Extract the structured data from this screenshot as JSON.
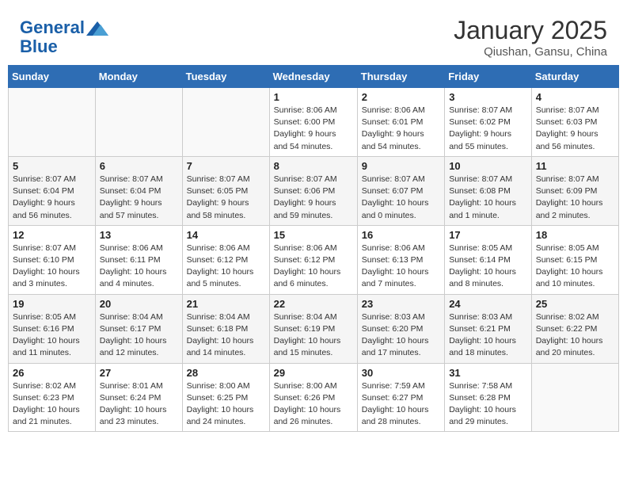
{
  "header": {
    "logo_line1": "General",
    "logo_line2": "Blue",
    "title": "January 2025",
    "subtitle": "Qiushan, Gansu, China"
  },
  "days_of_week": [
    "Sunday",
    "Monday",
    "Tuesday",
    "Wednesday",
    "Thursday",
    "Friday",
    "Saturday"
  ],
  "weeks": [
    {
      "days": [
        {
          "num": "",
          "info": ""
        },
        {
          "num": "",
          "info": ""
        },
        {
          "num": "",
          "info": ""
        },
        {
          "num": "1",
          "info": "Sunrise: 8:06 AM\nSunset: 6:00 PM\nDaylight: 9 hours\nand 54 minutes."
        },
        {
          "num": "2",
          "info": "Sunrise: 8:06 AM\nSunset: 6:01 PM\nDaylight: 9 hours\nand 54 minutes."
        },
        {
          "num": "3",
          "info": "Sunrise: 8:07 AM\nSunset: 6:02 PM\nDaylight: 9 hours\nand 55 minutes."
        },
        {
          "num": "4",
          "info": "Sunrise: 8:07 AM\nSunset: 6:03 PM\nDaylight: 9 hours\nand 56 minutes."
        }
      ]
    },
    {
      "days": [
        {
          "num": "5",
          "info": "Sunrise: 8:07 AM\nSunset: 6:04 PM\nDaylight: 9 hours\nand 56 minutes."
        },
        {
          "num": "6",
          "info": "Sunrise: 8:07 AM\nSunset: 6:04 PM\nDaylight: 9 hours\nand 57 minutes."
        },
        {
          "num": "7",
          "info": "Sunrise: 8:07 AM\nSunset: 6:05 PM\nDaylight: 9 hours\nand 58 minutes."
        },
        {
          "num": "8",
          "info": "Sunrise: 8:07 AM\nSunset: 6:06 PM\nDaylight: 9 hours\nand 59 minutes."
        },
        {
          "num": "9",
          "info": "Sunrise: 8:07 AM\nSunset: 6:07 PM\nDaylight: 10 hours\nand 0 minutes."
        },
        {
          "num": "10",
          "info": "Sunrise: 8:07 AM\nSunset: 6:08 PM\nDaylight: 10 hours\nand 1 minute."
        },
        {
          "num": "11",
          "info": "Sunrise: 8:07 AM\nSunset: 6:09 PM\nDaylight: 10 hours\nand 2 minutes."
        }
      ]
    },
    {
      "days": [
        {
          "num": "12",
          "info": "Sunrise: 8:07 AM\nSunset: 6:10 PM\nDaylight: 10 hours\nand 3 minutes."
        },
        {
          "num": "13",
          "info": "Sunrise: 8:06 AM\nSunset: 6:11 PM\nDaylight: 10 hours\nand 4 minutes."
        },
        {
          "num": "14",
          "info": "Sunrise: 8:06 AM\nSunset: 6:12 PM\nDaylight: 10 hours\nand 5 minutes."
        },
        {
          "num": "15",
          "info": "Sunrise: 8:06 AM\nSunset: 6:12 PM\nDaylight: 10 hours\nand 6 minutes."
        },
        {
          "num": "16",
          "info": "Sunrise: 8:06 AM\nSunset: 6:13 PM\nDaylight: 10 hours\nand 7 minutes."
        },
        {
          "num": "17",
          "info": "Sunrise: 8:05 AM\nSunset: 6:14 PM\nDaylight: 10 hours\nand 8 minutes."
        },
        {
          "num": "18",
          "info": "Sunrise: 8:05 AM\nSunset: 6:15 PM\nDaylight: 10 hours\nand 10 minutes."
        }
      ]
    },
    {
      "days": [
        {
          "num": "19",
          "info": "Sunrise: 8:05 AM\nSunset: 6:16 PM\nDaylight: 10 hours\nand 11 minutes."
        },
        {
          "num": "20",
          "info": "Sunrise: 8:04 AM\nSunset: 6:17 PM\nDaylight: 10 hours\nand 12 minutes."
        },
        {
          "num": "21",
          "info": "Sunrise: 8:04 AM\nSunset: 6:18 PM\nDaylight: 10 hours\nand 14 minutes."
        },
        {
          "num": "22",
          "info": "Sunrise: 8:04 AM\nSunset: 6:19 PM\nDaylight: 10 hours\nand 15 minutes."
        },
        {
          "num": "23",
          "info": "Sunrise: 8:03 AM\nSunset: 6:20 PM\nDaylight: 10 hours\nand 17 minutes."
        },
        {
          "num": "24",
          "info": "Sunrise: 8:03 AM\nSunset: 6:21 PM\nDaylight: 10 hours\nand 18 minutes."
        },
        {
          "num": "25",
          "info": "Sunrise: 8:02 AM\nSunset: 6:22 PM\nDaylight: 10 hours\nand 20 minutes."
        }
      ]
    },
    {
      "days": [
        {
          "num": "26",
          "info": "Sunrise: 8:02 AM\nSunset: 6:23 PM\nDaylight: 10 hours\nand 21 minutes."
        },
        {
          "num": "27",
          "info": "Sunrise: 8:01 AM\nSunset: 6:24 PM\nDaylight: 10 hours\nand 23 minutes."
        },
        {
          "num": "28",
          "info": "Sunrise: 8:00 AM\nSunset: 6:25 PM\nDaylight: 10 hours\nand 24 minutes."
        },
        {
          "num": "29",
          "info": "Sunrise: 8:00 AM\nSunset: 6:26 PM\nDaylight: 10 hours\nand 26 minutes."
        },
        {
          "num": "30",
          "info": "Sunrise: 7:59 AM\nSunset: 6:27 PM\nDaylight: 10 hours\nand 28 minutes."
        },
        {
          "num": "31",
          "info": "Sunrise: 7:58 AM\nSunset: 6:28 PM\nDaylight: 10 hours\nand 29 minutes."
        },
        {
          "num": "",
          "info": ""
        }
      ]
    }
  ]
}
